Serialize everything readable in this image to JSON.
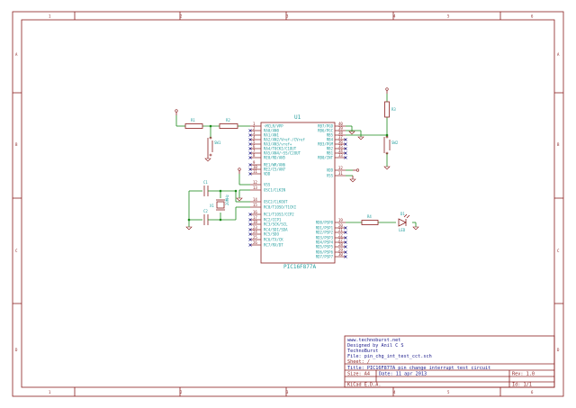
{
  "border": {
    "top_labels": [
      "1",
      "2",
      "3",
      "4",
      "5",
      "6"
    ],
    "side_labels": [
      "A",
      "B",
      "C",
      "D"
    ]
  },
  "ic": {
    "ref": "U1",
    "value": "PIC16F877A",
    "left_pins": [
      {
        "num": "1",
        "name": "~MCLR/VPP"
      },
      {
        "num": "2",
        "name": "RA0/AN0"
      },
      {
        "num": "3",
        "name": "RA1/AN1"
      },
      {
        "num": "4",
        "name": "RA2/AN2/Vref-/CVref"
      },
      {
        "num": "5",
        "name": "RA3/AN3/vref+"
      },
      {
        "num": "6",
        "name": "RA4/T0CKI/C1OUT"
      },
      {
        "num": "7",
        "name": "RA5/AN4/~SS/C2OUT"
      },
      {
        "num": "8",
        "name": "RE0/RD/AN5"
      },
      {
        "num": "9",
        "name": "RE1/WR/AN6"
      },
      {
        "num": "10",
        "name": "RE2/CS/AN7"
      },
      {
        "num": "11",
        "name": "VDD"
      },
      {
        "num": "12",
        "name": "VSS"
      },
      {
        "num": "13",
        "name": "OSC1/CLKIN"
      },
      {
        "num": "14",
        "name": "OSC2/CLKOUT"
      },
      {
        "num": "15",
        "name": "RC0/T1OSO/T1CKI"
      },
      {
        "num": "16",
        "name": "RC1/T1OSI/CCP2"
      },
      {
        "num": "17",
        "name": "RC2/CCP1"
      },
      {
        "num": "18",
        "name": "RC3/SCK/SCL"
      },
      {
        "num": "23",
        "name": "RC4/SDI/SDA"
      },
      {
        "num": "24",
        "name": "RC5/SDO"
      },
      {
        "num": "25",
        "name": "RC6/TX/CK"
      },
      {
        "num": "26",
        "name": "RC7/RX/DT"
      }
    ],
    "right_pins": [
      {
        "num": "40",
        "name": "RB7/PGD"
      },
      {
        "num": "39",
        "name": "RB6/PGC"
      },
      {
        "num": "38",
        "name": "RB5"
      },
      {
        "num": "37",
        "name": "RB4"
      },
      {
        "num": "36",
        "name": "RB3/PGM"
      },
      {
        "num": "35",
        "name": "RB2"
      },
      {
        "num": "34",
        "name": "RB1"
      },
      {
        "num": "33",
        "name": "RB0/INT"
      },
      {
        "num": "32",
        "name": "VDD"
      },
      {
        "num": "31",
        "name": "VSS"
      },
      {
        "num": "19",
        "name": "RD0/PSP0"
      },
      {
        "num": "20",
        "name": "RD1/PSP1"
      },
      {
        "num": "21",
        "name": "RD2/PSP2"
      },
      {
        "num": "22",
        "name": "RD3/PSP3"
      },
      {
        "num": "27",
        "name": "RD4/PSP4"
      },
      {
        "num": "28",
        "name": "RD5/PSP5"
      },
      {
        "num": "29",
        "name": "RD6/PSP6"
      },
      {
        "num": "30",
        "name": "RD7/PSP7"
      }
    ]
  },
  "components": {
    "r1": "R1",
    "r2": "R2",
    "r3": "R3",
    "r4": "R4",
    "sw1": "SW1",
    "sw2": "SW2",
    "c1": "C1",
    "c2": "C2",
    "x1": "X1",
    "x1_value": "20MHz",
    "d1": "D1",
    "led": "LED"
  },
  "title_block": {
    "website": "www.technoburst.net",
    "designer": "Designed by Anil C S",
    "company": "TechnoBurst",
    "file": "File: pin_chg_int_test_cct.sch",
    "sheet": "Sheet: /",
    "title": "Title: PIC16F877A pin change interrupt test circuit",
    "size": "Size: A4",
    "date": "Date: 11 apr 2013",
    "rev": "Rev: 1.0",
    "tool": "KiCad E.D.A.",
    "id": "Id: 1/1"
  }
}
